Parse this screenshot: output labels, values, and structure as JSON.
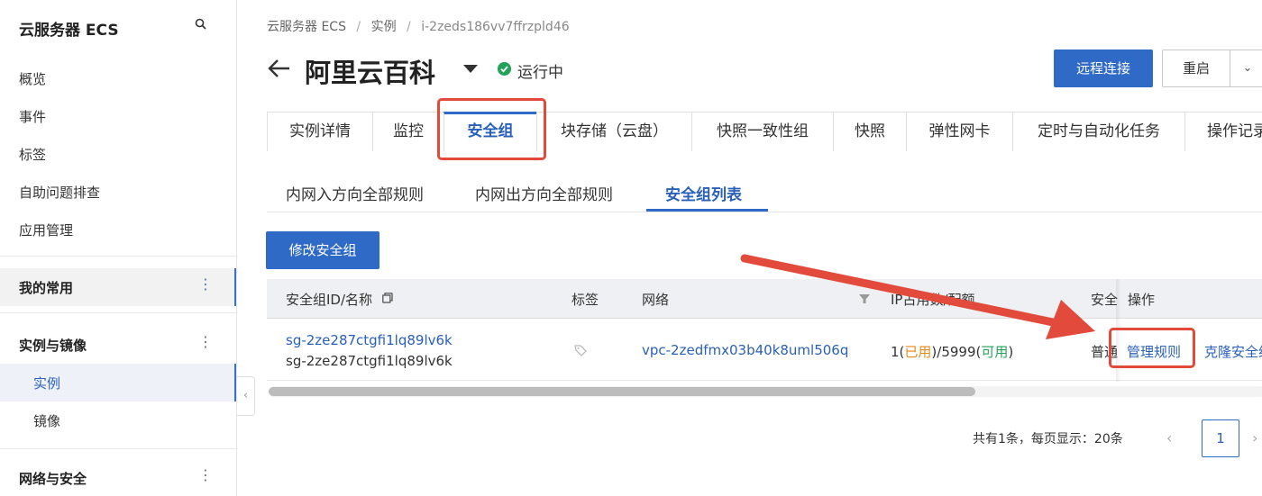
{
  "sidebar": {
    "title": "云服务器 ECS",
    "items": [
      "概览",
      "事件",
      "标签",
      "自助问题排查",
      "应用管理"
    ],
    "groups": {
      "favorites": "我的常用",
      "instances_images": "实例与镜像",
      "instance": "实例",
      "image": "镜像",
      "network_security": "网络与安全"
    },
    "more_glyph": "⋮",
    "collapse_glyph": "‹"
  },
  "breadcrumb": {
    "root": "云服务器 ECS",
    "parent": "实例",
    "current": "i-2zeds186vv7ffrzpld46",
    "sep": "/"
  },
  "header": {
    "title": "阿里云百科",
    "status": "运行中",
    "remote_connect": "远程连接",
    "restart": "重启",
    "more_glyph": "⌄"
  },
  "tabs": [
    "实例详情",
    "监控",
    "安全组",
    "块存储（云盘）",
    "快照一致性组",
    "快照",
    "弹性网卡",
    "定时与自动化任务",
    "操作记录"
  ],
  "subtabs": [
    "内网入方向全部规则",
    "内网出方向全部规则",
    "安全组列表"
  ],
  "edit_button": "修改安全组",
  "table": {
    "headers": {
      "id_name": "安全组ID/名称",
      "tags": "标签",
      "network": "网络",
      "ip_quota": "IP占用数/配额",
      "type": "安全",
      "actions": "操作"
    },
    "row": {
      "id": "sg-2ze287ctgfi1lq89lv6k",
      "name": "sg-2ze287ctgfi1lq89lv6k",
      "vpc": "vpc-2zedfmx03b40k8uml506q",
      "ip_used_num": "1(",
      "ip_used_label": "已用",
      "ip_mid": ")/5999(",
      "ip_avail_label": "可用",
      "ip_end": ")",
      "type": "普通",
      "manage_rules": "管理规则",
      "clone": "克隆安全组"
    }
  },
  "pagination": {
    "info": "共有1条，每页显示：20条",
    "current": "1",
    "prev": "‹",
    "next": "›"
  },
  "colors": {
    "primary": "#2f6ac6",
    "link": "#2a60b8",
    "annotation_red": "#e24a3b",
    "status_green": "#23a35a",
    "used_orange": "#e58a1a"
  }
}
